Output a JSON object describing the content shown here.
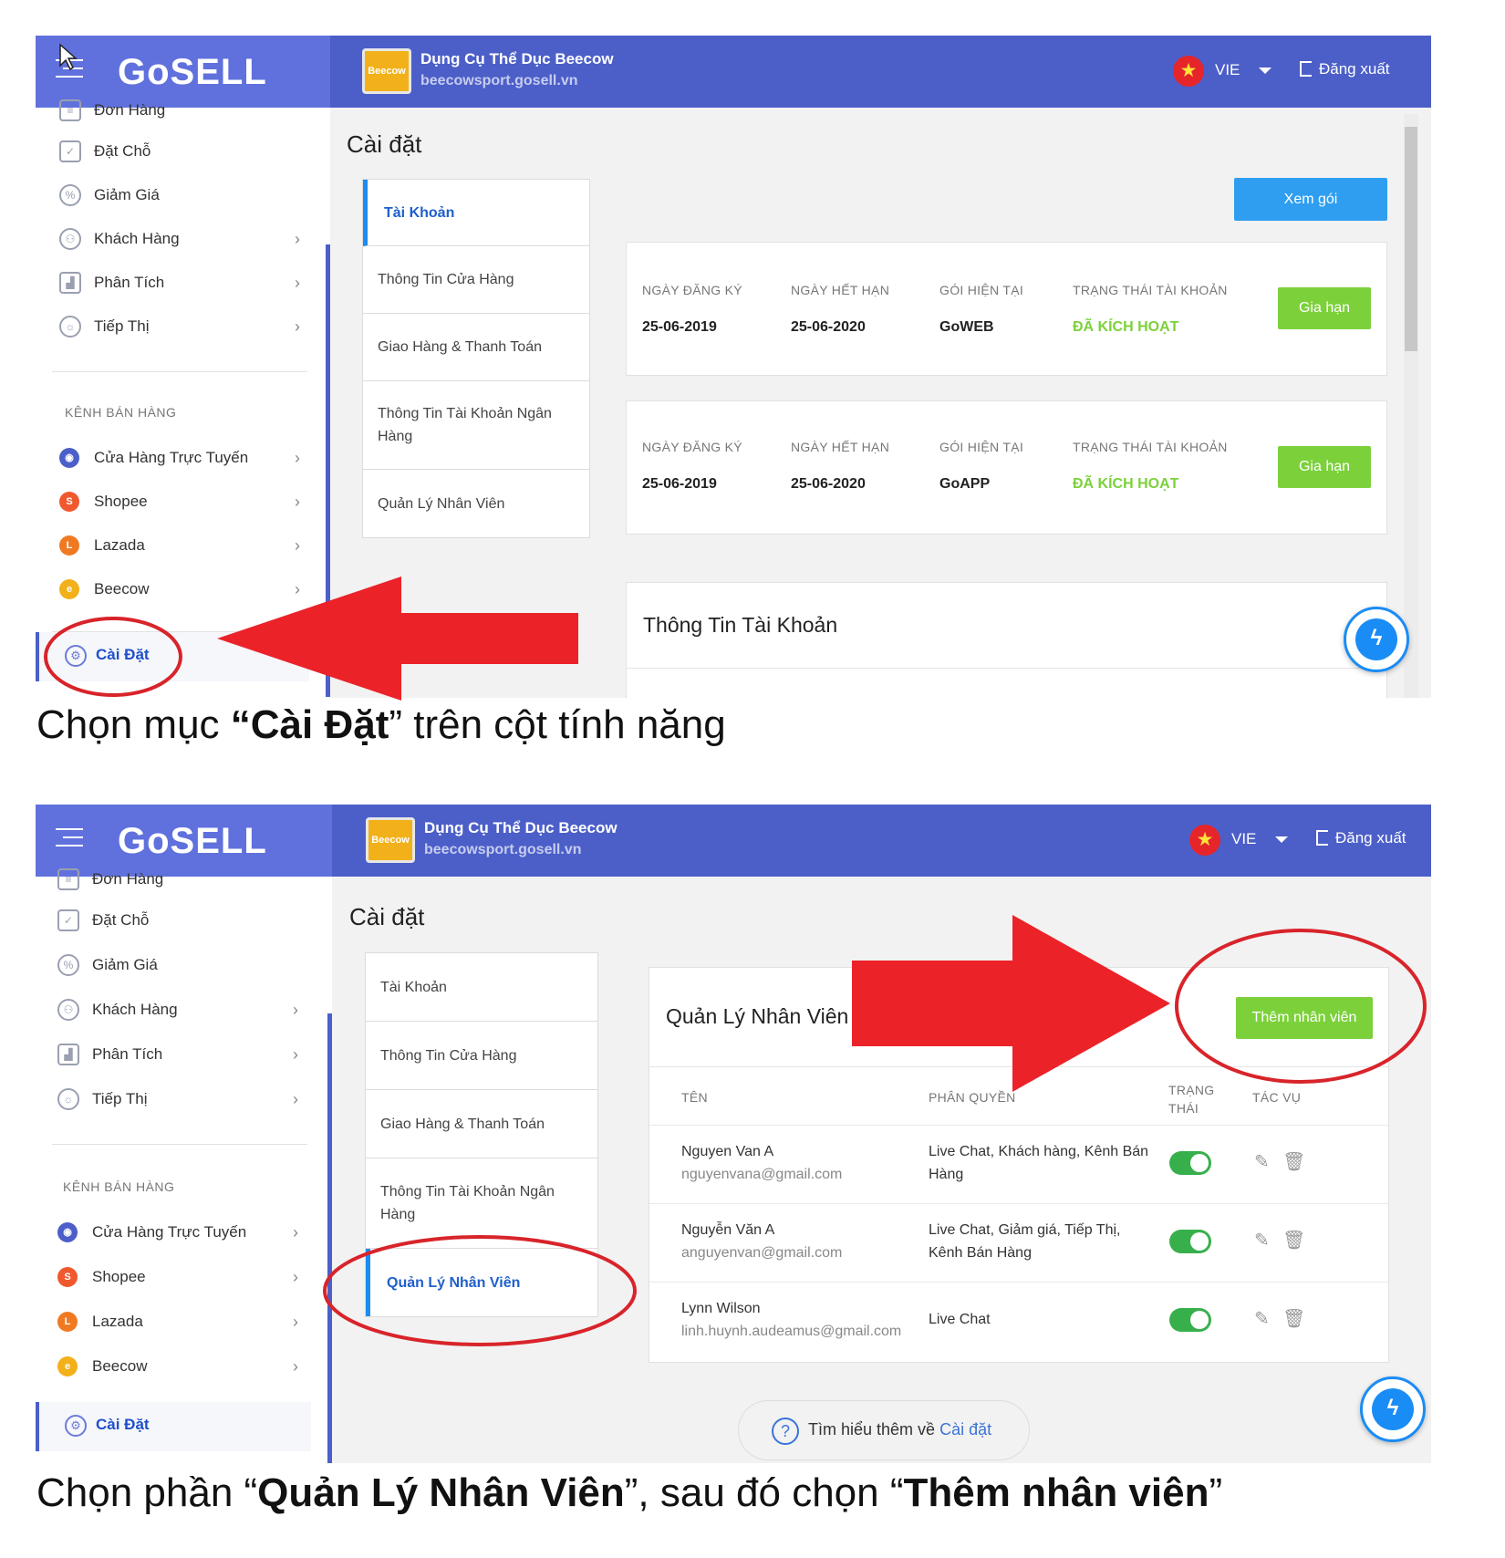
{
  "header": {
    "logo_text": "GoSELL",
    "store_name": "Dụng Cụ Thể Dục Beecow",
    "store_url": "beecowsport.gosell.vn",
    "store_logo_text": "Beecow",
    "language": "VIE",
    "logout_label": "Đăng xuất"
  },
  "sidebar": {
    "partial_item": "Đơn Hàng",
    "items": [
      {
        "label": "Đặt Chỗ",
        "icon": "calendar-icon"
      },
      {
        "label": "Giảm Giá",
        "icon": "discount-icon"
      },
      {
        "label": "Khách Hàng",
        "icon": "users-icon"
      },
      {
        "label": "Phân Tích",
        "icon": "chart-icon"
      },
      {
        "label": "Tiếp Thị",
        "icon": "bulb-icon"
      }
    ],
    "channel_heading": "KÊNH BÁN HÀNG",
    "channels": [
      {
        "label": "Cửa Hàng Trực Tuyến",
        "color": "#4c5fc8"
      },
      {
        "label": "Shopee",
        "color": "#f0582e"
      },
      {
        "label": "Lazada",
        "color": "#f07a22"
      },
      {
        "label": "Beecow",
        "color": "#f2b11a"
      }
    ],
    "settings_label": "Cài Đặt"
  },
  "settings": {
    "page_title": "Cài đặt",
    "tabs": [
      "Tài Khoản",
      "Thông Tin Cửa Hàng",
      "Giao Hàng & Thanh Toán",
      "Thông Tin Tài Khoản Ngân Hàng",
      "Quản Lý Nhân Viên"
    ]
  },
  "account": {
    "view_plans_button": "Xem gói",
    "columns": [
      "NGÀY ĐĂNG KÝ",
      "NGÀY HẾT HẠN",
      "GÓI HIỆN TẠI",
      "TRẠNG THÁI TÀI KHOẢN"
    ],
    "plans": [
      {
        "registered": "25-06-2019",
        "expires": "25-06-2020",
        "package": "GoWEB",
        "status": "ĐÃ KÍCH HOẠT",
        "renew_label": "Gia hạn"
      },
      {
        "registered": "25-06-2019",
        "expires": "25-06-2020",
        "package": "GoAPP",
        "status": "ĐÃ KÍCH HOẠT",
        "renew_label": "Gia hạn"
      }
    ],
    "account_info_title": "Thông Tin Tài Khoản"
  },
  "staff": {
    "title": "Quản Lý Nhân Viên",
    "add_button": "Thêm nhân viên",
    "columns": {
      "name": "TÊN",
      "role": "PHÂN QUYỀN",
      "status_line1": "TRẠNG",
      "status_line2": "THÁI",
      "actions": "TÁC VỤ"
    },
    "rows": [
      {
        "name": "Nguyen Van A",
        "email": "nguyenvana@gmail.com",
        "perm_line1": "Live Chat, Khách hàng, Kênh Bán",
        "perm_line2": "Hàng",
        "active": true
      },
      {
        "name": "Nguyễn Văn A",
        "email": "anguyenvan@gmail.com",
        "perm_line1": "Live Chat, Giảm giá, Tiếp Thị,",
        "perm_line2": "Kênh Bán Hàng",
        "active": true
      },
      {
        "name": "Lynn Wilson",
        "email": "linh.huynh.audeamus@gmail.com",
        "perm_line1": "Live Chat",
        "perm_line2": "",
        "active": true
      }
    ],
    "help_prefix": "Tìm hiểu thêm về",
    "help_link": "Cài đặt"
  },
  "captions": {
    "step1_pre": "Chọn mục ",
    "step1_bold": "“Cài Đặt",
    "step1_post": "” trên cột tính năng",
    "step2_pre": "Chọn phần “",
    "step2_bold1": "Quản Lý Nhân Viên",
    "step2_mid": "”, sau đó chọn “",
    "step2_bold2": "Thêm nhân viên",
    "step2_post": "”"
  },
  "colors": {
    "header": "#4c5fc8",
    "accent_green": "#7cd13b",
    "accent_blue": "#2f9ef0",
    "arrow_red": "#ec2229"
  }
}
